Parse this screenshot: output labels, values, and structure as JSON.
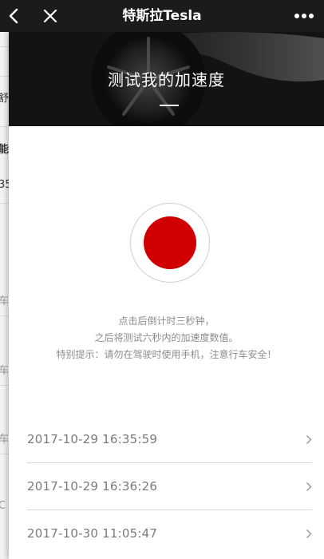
{
  "topbar": {
    "title": "特斯拉Tesla",
    "back_icon": "chevron-left-icon",
    "close_icon": "close-icon",
    "more_icon": "more-dots-icon",
    "background": "#1b1b1b"
  },
  "underlay": {
    "fragments": [
      "舒",
      "能)",
      "35",
      "车",
      "车",
      "车",
      "C"
    ]
  },
  "hero": {
    "title": "测试我的加速度"
  },
  "record_button": {
    "icon": "record-dot-icon",
    "color": "#d10000"
  },
  "instructions": {
    "line1": "点击后倒计时三秒钟，",
    "line2": "之后将测试六秒内的加速度数值。",
    "line3": "特别提示：请勿在驾驶时使用手机，注意行车安全！"
  },
  "history": {
    "items": [
      {
        "timestamp": "2017-10-29 16:35:59"
      },
      {
        "timestamp": "2017-10-29 16:36:26"
      },
      {
        "timestamp": "2017-10-30 11:05:47"
      }
    ]
  }
}
